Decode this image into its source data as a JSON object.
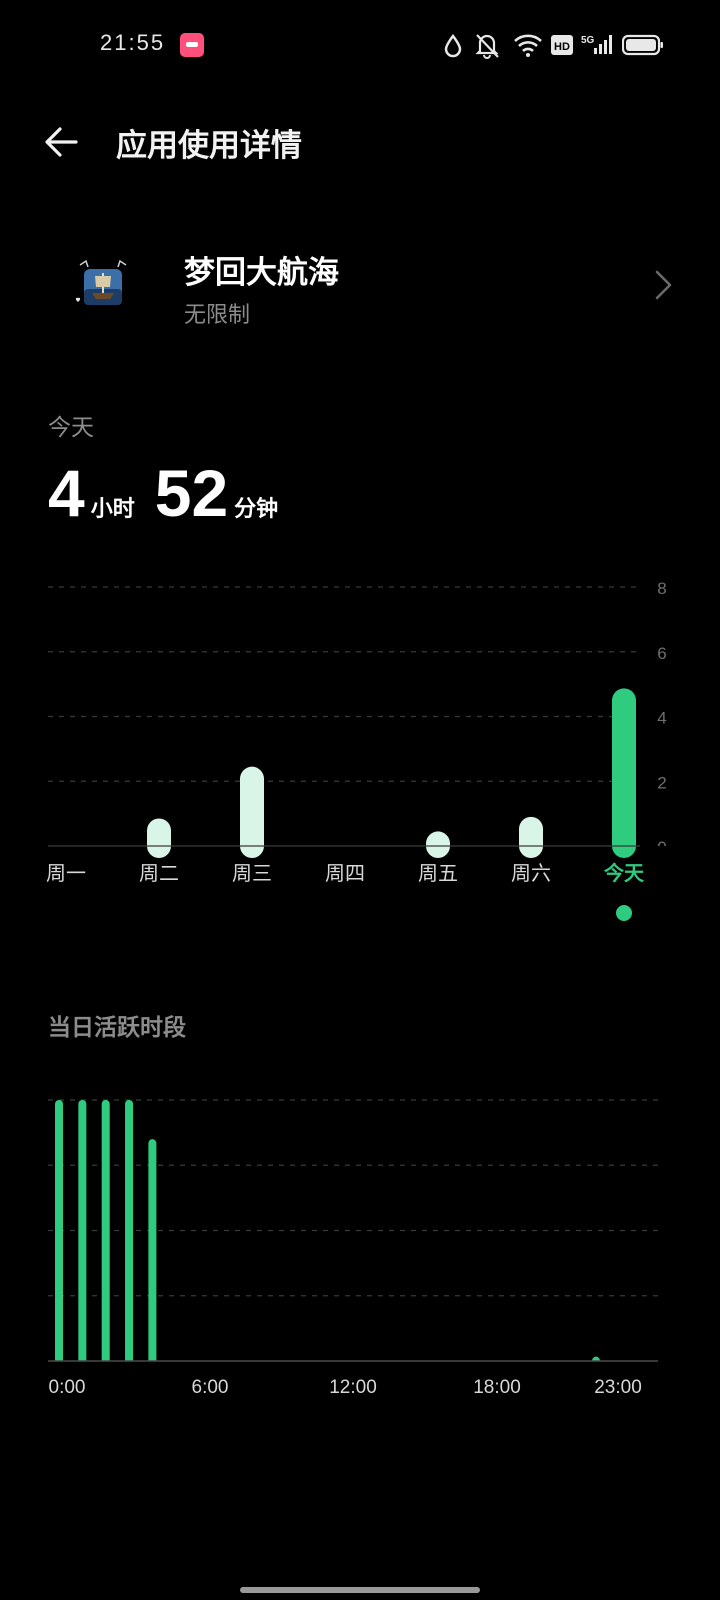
{
  "status_bar": {
    "time": "21:55",
    "icons": [
      "notification-app-icon",
      "water-drop-icon",
      "mute-icon",
      "wifi-icon",
      "hd-icon",
      "signal-5g-icon",
      "battery-icon"
    ],
    "hd_label": "HD",
    "network_label": "5G"
  },
  "header": {
    "title": "应用使用详情",
    "back_icon": "back-arrow-icon"
  },
  "app": {
    "name": "梦回大航海",
    "limit": "无限制"
  },
  "summary": {
    "label": "今天",
    "hours": "4",
    "hours_unit": "小时",
    "minutes": "52",
    "minutes_unit": "分钟"
  },
  "daily_section_title": "当日活跃时段",
  "colors": {
    "accent": "#2fcb7e",
    "past_bar": "#d9f5e8",
    "grid": "#3a3a3a",
    "axis_text": "#6f6f6f"
  },
  "chart_data": [
    {
      "type": "bar",
      "categories": [
        "周一",
        "周二",
        "周三",
        "周四",
        "周五",
        "周六",
        "今天"
      ],
      "values": [
        0,
        0.85,
        2.45,
        0,
        0.45,
        0.9,
        4.87
      ],
      "ylim": [
        0,
        8
      ],
      "yticks": [
        "0",
        "2",
        "4",
        "6",
        "8"
      ],
      "highlight": "今天",
      "grid": true
    },
    {
      "type": "bar",
      "x": [
        0,
        1,
        2,
        3,
        4,
        23
      ],
      "values": [
        60,
        60,
        60,
        60,
        51,
        1
      ],
      "xlim": [
        0,
        24
      ],
      "ylim": [
        0,
        60
      ],
      "xticks": [
        "0:00",
        "6:00",
        "12:00",
        "18:00",
        "23:00"
      ],
      "xtick_positions": [
        0,
        6,
        12,
        18,
        23
      ],
      "grid": true
    }
  ]
}
